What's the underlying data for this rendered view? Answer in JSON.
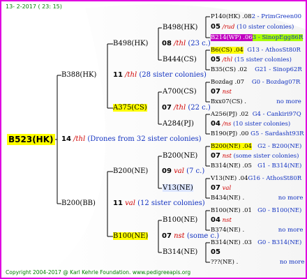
{
  "date": "13- 2-2017 ( 23: 15)",
  "footer": "Copyright 2004-2017 @ Karl Kehrle Foundation.   www.pedigreeapis.org",
  "root": {
    "id": "B523(HK)",
    "gen": "14",
    "mark": "/thl",
    "note": "(Drones from 32 sister colonies)"
  },
  "g1": [
    {
      "id": "B388(HK)",
      "gen": "11",
      "mark": "/thl",
      "note": "(28 sister colonies)"
    },
    {
      "id": "B200(BB)",
      "gen": "11",
      "mark": "val",
      "note": "(12 sister colonies)"
    }
  ],
  "g2": [
    {
      "id": "B498(HK)",
      "gen": "08",
      "mark": "/thl",
      "note": "(23 c.)"
    },
    {
      "id": "A375(CS)",
      "gen": "07",
      "mark": "/thl",
      "note": "(22 c.)"
    },
    {
      "id": "B200(NE)",
      "gen": "09",
      "mark": "val",
      "note": "(7 c.)"
    },
    {
      "id": "B100(NE)",
      "gen": "07",
      "mark": "nst",
      "note": "(some c.)"
    }
  ],
  "g3": [
    {
      "id": "B498(HK)"
    },
    {
      "id": "B444(CS)"
    },
    {
      "id": "A700(CS)"
    },
    {
      "id": "A284(PJ)"
    },
    {
      "id": "B200(NE)"
    },
    {
      "id": "V13(NE)"
    },
    {
      "id": "B100(NE)"
    },
    {
      "id": "B314(NE)"
    }
  ],
  "g4": [
    {
      "a": "P140(HK) .08",
      "b": "2 - PrimGreen00"
    },
    {
      "gen": "05",
      "mark": "/rud",
      "note": "(10 sister colonies)"
    },
    {
      "a": "B214(WP) .06",
      "b": "3 - SinopEgg86R"
    },
    {
      "a": "B6(CS) .04",
      "b": "G13 - AthosSt80R"
    },
    {
      "gen": "05",
      "mark": "/thl",
      "note": "(15 sister colonies)"
    },
    {
      "a": "B35(CS) .02",
      "b": "G21 - Sinop62R"
    },
    {
      "a": "Bozdag .07",
      "b": "G0 - Bozdag07R"
    },
    {
      "gen": "07",
      "mark": "nst",
      "note": ""
    },
    {
      "a": "Bxx07(CS) .",
      "b": "no more"
    },
    {
      "a": "A256(PJ) .02",
      "b": "G4 - Cankiri97Q"
    },
    {
      "gen": "04",
      "mark": "/ns",
      "note": "(10 sister colonies)"
    },
    {
      "a": "B190(PJ) .00",
      "b": "G5 - Sardasht93R"
    },
    {
      "a": "B200(NE) .04",
      "b": "G2 - B200(NE)"
    },
    {
      "gen": "07",
      "mark": "nst",
      "note": "(some sister colonies)"
    },
    {
      "a": "B314(NE) .05",
      "b": "G1 - B314(NE)"
    },
    {
      "a": "V13(NE) .04",
      "b": "G16 - AthosSt80R"
    },
    {
      "gen": "07",
      "mark": "val",
      "note": ""
    },
    {
      "a": "B434(NE) .",
      "b": "no more"
    },
    {
      "a": "B100(NE) .01",
      "b": "G0 - B100(NE)"
    },
    {
      "gen": "04",
      "mark": "nst",
      "note": ""
    },
    {
      "a": "B374(NE) .",
      "b": "no more"
    },
    {
      "a": "B314(NE) .03",
      "b": "G0 - B314(NE)"
    },
    {
      "gen": "05",
      "mark": "",
      "note": ""
    },
    {
      "a": "???(NE) .",
      "b": "no more"
    }
  ],
  "colors": {
    "frame": "#e000e0",
    "highlight": "#ffff00",
    "green": "#aaff00",
    "purple": "#c000c0",
    "mark": "#d00000",
    "link": "#1030c0"
  }
}
